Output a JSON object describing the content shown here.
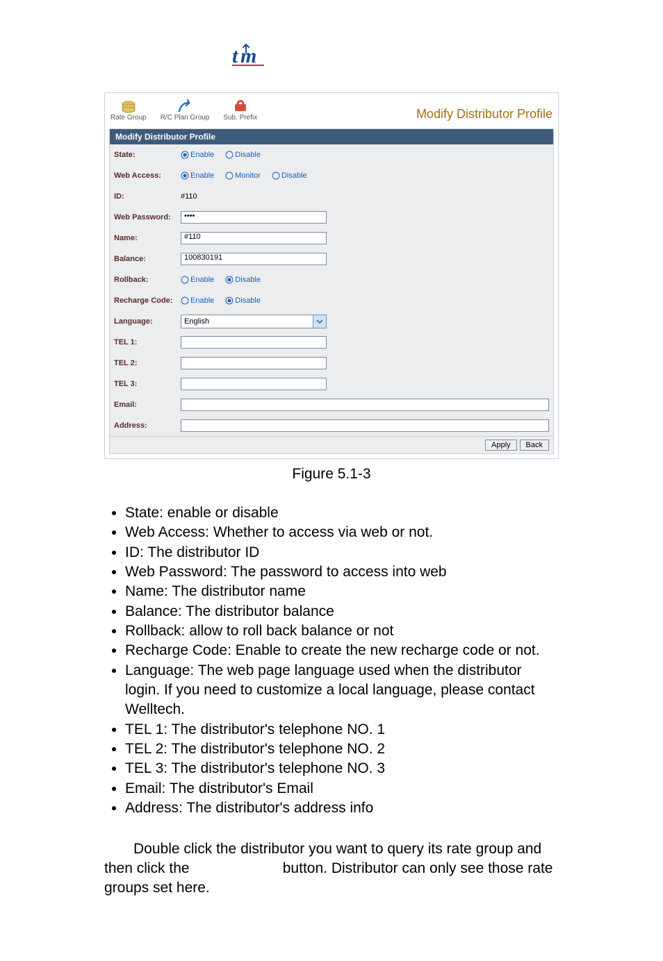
{
  "logo_text": "tm",
  "toolbar": {
    "tools": [
      {
        "name": "rate-group-tool",
        "label": "Rate Group"
      },
      {
        "name": "rc-plan-group-tool",
        "label": "R/C Plan Group"
      },
      {
        "name": "sub-prefix-tool",
        "label": "Sub. Prefix"
      }
    ],
    "title": "Modify Distributor Profile"
  },
  "form": {
    "header": "Modify Distributor Profile",
    "rows": {
      "state": {
        "label": "State:",
        "options": [
          "Enable",
          "Disable"
        ],
        "selected": "Enable"
      },
      "web_access": {
        "label": "Web Access:",
        "options": [
          "Enable",
          "Monitor",
          "Disable"
        ],
        "selected": "Enable"
      },
      "id": {
        "label": "ID:",
        "value": "#110"
      },
      "web_password": {
        "label": "Web Password:",
        "value": "••••"
      },
      "name": {
        "label": "Name:",
        "value": "#110"
      },
      "balance": {
        "label": "Balance:",
        "value": "100830191"
      },
      "rollback": {
        "label": "Rollback:",
        "options": [
          "Enable",
          "Disable"
        ],
        "selected": "Disable"
      },
      "recharge_code": {
        "label": "Recharge Code:",
        "options": [
          "Enable",
          "Disable"
        ],
        "selected": "Disable"
      },
      "language": {
        "label": "Language:",
        "value": "English"
      },
      "tel1": {
        "label": "TEL 1:",
        "value": ""
      },
      "tel2": {
        "label": "TEL 2:",
        "value": ""
      },
      "tel3": {
        "label": "TEL 3:",
        "value": ""
      },
      "email": {
        "label": "Email:",
        "value": ""
      },
      "address": {
        "label": "Address:",
        "value": ""
      }
    },
    "buttons": {
      "apply": "Apply",
      "back": "Back"
    }
  },
  "caption": "Figure 5.1-3",
  "bullets": [
    "State: enable or disable",
    "Web Access: Whether to access via web or not.",
    "ID: The distributor ID",
    "Web Password: The password to access into web",
    "Name: The distributor name",
    "Balance: The distributor balance",
    "Rollback: allow to roll back balance or not",
    "Recharge Code: Enable to create the new recharge code or not.",
    "Language: The web page language used when the distributor login. If you need to customize a local language, please contact Welltech.",
    "TEL 1: The distributor's telephone NO. 1",
    "TEL 2: The distributor's telephone NO. 2",
    "TEL 3: The distributor's telephone NO. 3",
    "Email: The distributor's Email",
    "Address: The distributor's address info"
  ],
  "paragraph": "Double click the distributor you want to query its rate group and then click the                       button. Distributor can only see those rate groups set here."
}
